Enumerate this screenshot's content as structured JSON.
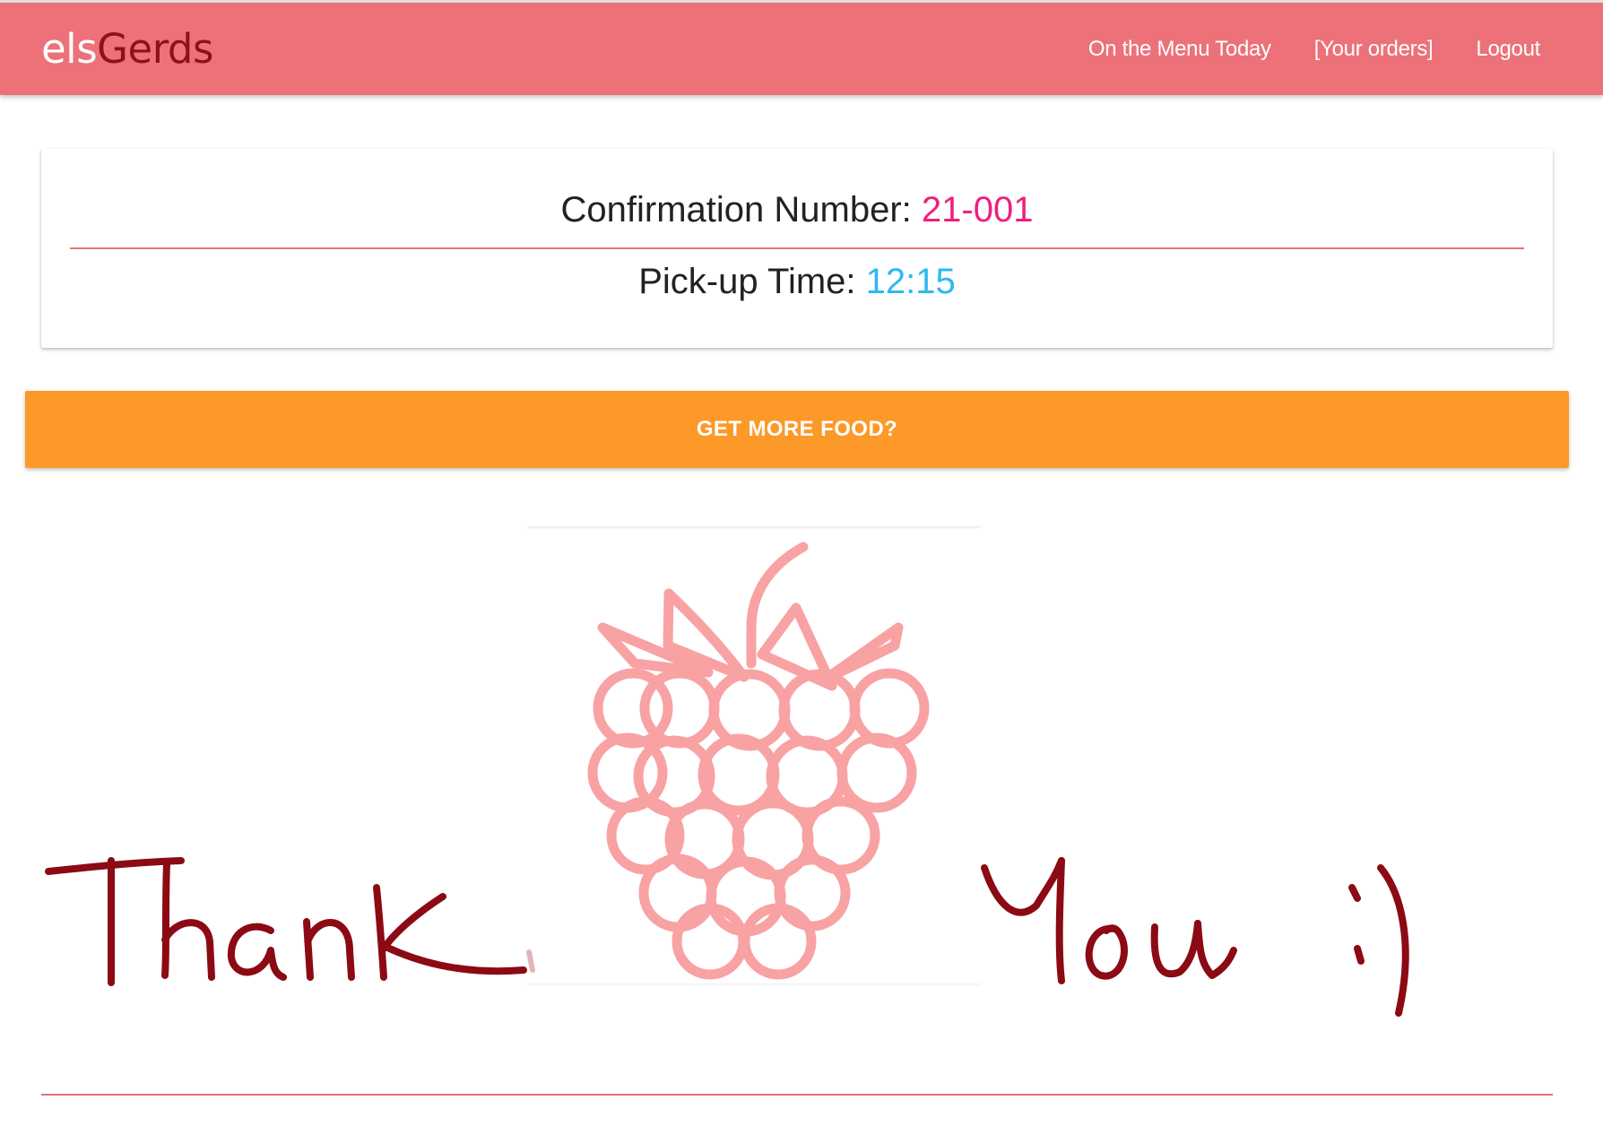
{
  "navbar": {
    "brand_part1": "els",
    "brand_part2": "Gerds",
    "links": [
      "On the Menu Today",
      "[Your orders]",
      "Logout"
    ]
  },
  "confirmation": {
    "number_label": "Confirmation Number:",
    "number_value": "21-001",
    "time_label": "Pick-up Time:",
    "time_value": "12:15"
  },
  "actions": {
    "more_food_label": "GET MORE FOOD?"
  },
  "thank_you_image": {
    "text": "Thank You :)",
    "icon": "raspberry-icon"
  },
  "colors": {
    "navbar": "#ec7179",
    "brand_accent": "#8e1018",
    "confirmation_number": "#ee1f7c",
    "pickup_time": "#2cb9f0",
    "button": "#fc9929",
    "handwriting": "#8b0a14",
    "raspberry": "#f8a2a4"
  }
}
